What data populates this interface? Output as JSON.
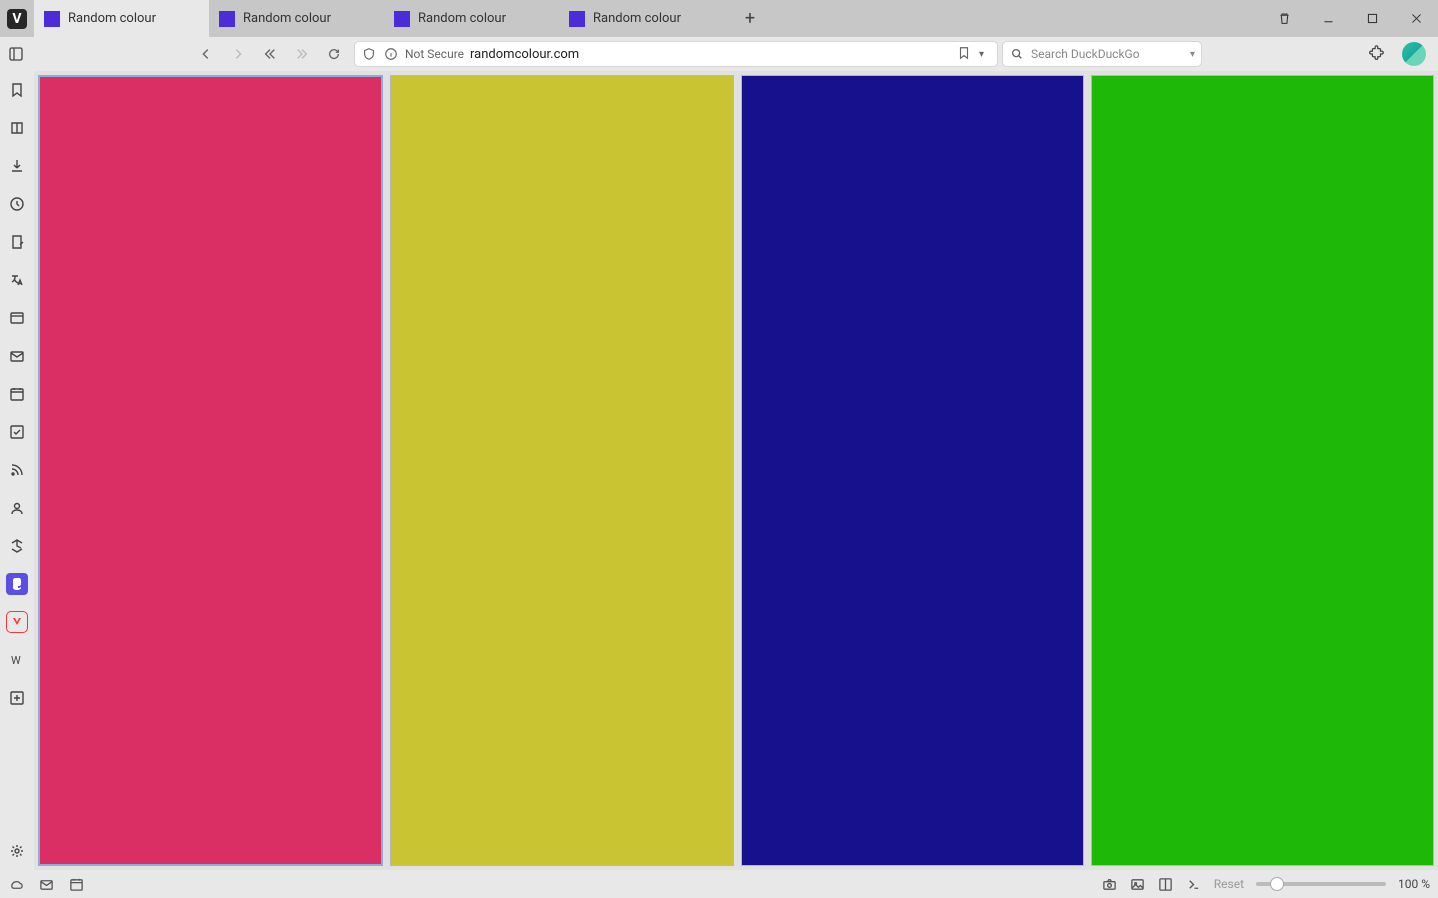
{
  "tabs": [
    {
      "title": "Random colour"
    },
    {
      "title": "Random colour"
    },
    {
      "title": "Random colour"
    },
    {
      "title": "Random colour"
    }
  ],
  "addr": {
    "not_secure": "Not Secure",
    "url": "randomcolour.com"
  },
  "search": {
    "placeholder": "Search DuckDuckGo"
  },
  "tiles": {
    "colors": [
      "#da2f65",
      "#c9c432",
      "#17118e",
      "#1eb908"
    ]
  },
  "status": {
    "reset": "Reset",
    "zoom": "100 %"
  }
}
